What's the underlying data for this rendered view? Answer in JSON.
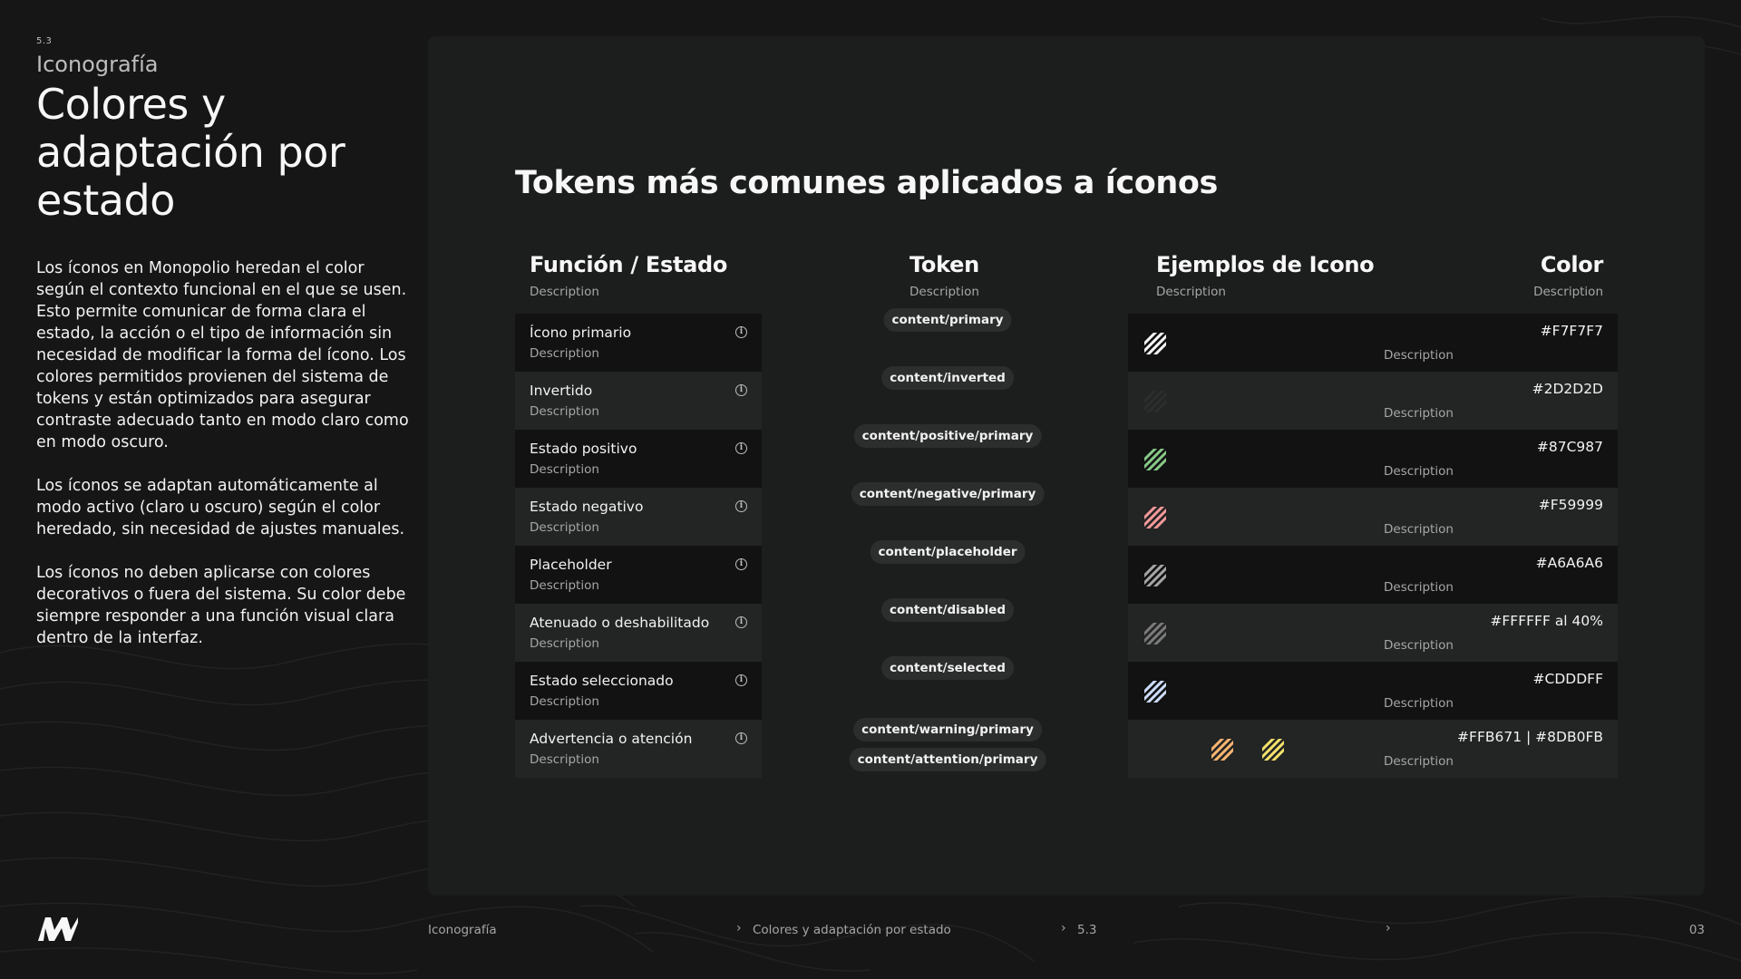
{
  "section": {
    "number": "5.3",
    "name": "Iconografía"
  },
  "title": "Colores y adaptación por estado",
  "paragraphs": [
    "Los íconos en Monopolio heredan el color según el contexto funcional en el que se usen. Esto permite comunicar de forma clara el estado, la acción o el tipo de información sin necesidad de modificar la forma del ícono. Los colores permitidos provienen del sistema de tokens y están optimizados para asegurar contraste adecuado tanto en modo claro como en modo oscuro.",
    "Los íconos se adaptan automáticamente al modo activo (claro u oscuro) según el color heredado, sin necesidad de ajustes manuales.",
    "Los íconos no deben aplicarse con colores decorativos o fuera del sistema. Su color debe siempre responder a una función visual clara dentro de la interfaz."
  ],
  "panel": {
    "title": "Tokens más comunes aplicados a íconos",
    "columns": {
      "function": {
        "label": "Función / Estado",
        "desc": "Description"
      },
      "token": {
        "label": "Token",
        "desc": "Description"
      },
      "examples": {
        "label": "Ejemplos de Icono",
        "desc": "Description"
      },
      "color": {
        "label": "Color",
        "desc": "Description"
      }
    },
    "rows": [
      {
        "function": "Ícono primario",
        "desc": "Description",
        "tokens": [
          "content/primary"
        ],
        "color_label": "#F7F7F7",
        "icon_colors": [
          "#F7F7F7"
        ],
        "ex_desc": "Description"
      },
      {
        "function": "Invertido",
        "desc": "Description",
        "tokens": [
          "content/inverted"
        ],
        "color_label": "#2D2D2D",
        "icon_colors": [
          "#2D2D2D"
        ],
        "ex_desc": "Description"
      },
      {
        "function": "Estado positivo",
        "desc": "Description",
        "tokens": [
          "content/positive/primary"
        ],
        "color_label": "#87C987",
        "icon_colors": [
          "#87C987"
        ],
        "ex_desc": "Description"
      },
      {
        "function": "Estado negativo",
        "desc": "Description",
        "tokens": [
          "content/negative/primary"
        ],
        "color_label": "#F59999",
        "icon_colors": [
          "#F59999"
        ],
        "ex_desc": "Description"
      },
      {
        "function": "Placeholder",
        "desc": "Description",
        "tokens": [
          "content/placeholder"
        ],
        "color_label": "#A6A6A6",
        "icon_colors": [
          "#A6A6A6"
        ],
        "ex_desc": "Description"
      },
      {
        "function": "Atenuado o deshabilitado",
        "desc": "Description",
        "tokens": [
          "content/disabled"
        ],
        "color_label": "#FFFFFF al 40%",
        "icon_colors": [
          "rgba(255,255,255,0.4)"
        ],
        "ex_desc": "Description"
      },
      {
        "function": "Estado seleccionado",
        "desc": "Description",
        "tokens": [
          "content/selected"
        ],
        "color_label": "#CDDDFF",
        "icon_colors": [
          "#CDDDFF"
        ],
        "ex_desc": "Description"
      },
      {
        "function": "Advertencia o atención",
        "desc": "Description",
        "tokens": [
          "content/warning/primary",
          "content/attention/primary"
        ],
        "color_label": "#FFB671 | #8DB0FB",
        "icon_colors": [
          "#FFB671",
          "#F5E26B"
        ],
        "ex_desc": "Description"
      }
    ]
  },
  "footer": {
    "crumbs": [
      "Iconografía",
      "Colores y adaptación por estado",
      "5.3"
    ],
    "page": "03"
  }
}
